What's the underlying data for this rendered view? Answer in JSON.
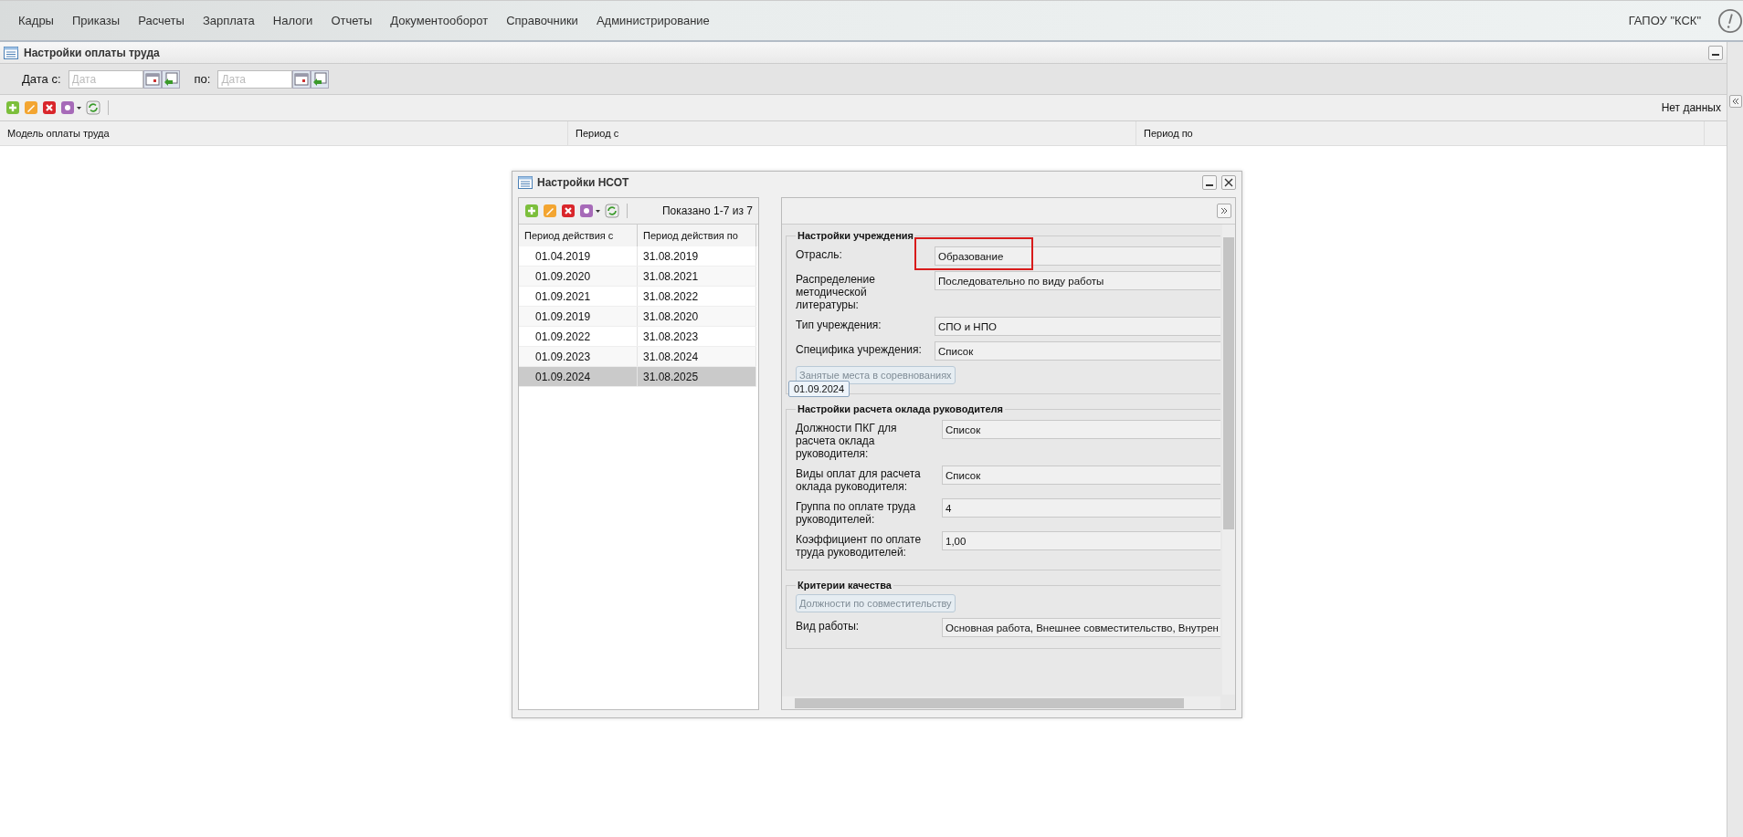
{
  "menu": [
    {
      "label": "Кадры"
    },
    {
      "label": "Приказы"
    },
    {
      "label": "Расчеты"
    },
    {
      "label": "Зарплата"
    },
    {
      "label": "Налоги"
    },
    {
      "label": "Отчеты"
    },
    {
      "label": "Документооборот"
    },
    {
      "label": "Справочники"
    },
    {
      "label": "Администрирование"
    }
  ],
  "organization": "ГАПОУ \"КСК\"",
  "panel": {
    "title": "Настройки оплаты труда",
    "filter": {
      "from_label": "Дата с:",
      "from_placeholder": "Дата",
      "to_label": "по:",
      "to_placeholder": "Дата"
    },
    "status": "Нет данных",
    "columns": [
      "Модель оплаты труда",
      "Период с",
      "Период по"
    ]
  },
  "dialog": {
    "title": "Настройки НСОТ",
    "count": "Показано 1-7 из 7",
    "columns": [
      "Период действия с",
      "Период действия по"
    ],
    "rows": [
      {
        "from": "01.04.2019",
        "to": "31.08.2019",
        "selected": false
      },
      {
        "from": "01.09.2020",
        "to": "31.08.2021",
        "selected": false
      },
      {
        "from": "01.09.2021",
        "to": "31.08.2022",
        "selected": false
      },
      {
        "from": "01.09.2019",
        "to": "31.08.2020",
        "selected": false
      },
      {
        "from": "01.09.2022",
        "to": "31.08.2023",
        "selected": false
      },
      {
        "from": "01.09.2023",
        "to": "31.08.2024",
        "selected": false
      },
      {
        "from": "01.09.2024",
        "to": "31.08.2025",
        "selected": true
      }
    ],
    "sections": [
      {
        "title": "Настройки учреждения",
        "tooltip": "01.09.2024",
        "items": [
          {
            "kind": "field",
            "label": "Отрасль:",
            "value": "Образование",
            "highlighted": true
          },
          {
            "kind": "field",
            "label": "Распределение методической литературы:",
            "value": "Последовательно по виду работы",
            "highlighted": false
          },
          {
            "kind": "field",
            "label": "Тип учреждения:",
            "value": "СПО и НПО",
            "highlighted": false
          },
          {
            "kind": "field",
            "label": "Специфика учреждения:",
            "value": "Список",
            "highlighted": false
          },
          {
            "kind": "button",
            "label": "Занятые места в соревнованиях",
            "disabled": true
          }
        ]
      },
      {
        "title": "Настройки расчета оклада руководителя",
        "items": [
          {
            "kind": "field",
            "label": "Должности ПКГ для расчета оклада руководителя:",
            "value": "Список",
            "highlighted": false
          },
          {
            "kind": "field",
            "label": "Виды оплат для расчета оклада руководителя:",
            "value": "Список",
            "highlighted": false
          },
          {
            "kind": "field",
            "label": "Группа по оплате труда руководителей:",
            "value": "4",
            "highlighted": false
          },
          {
            "kind": "field",
            "label": "Коэффициент по оплате труда руководителей:",
            "value": "1,00",
            "highlighted": false
          }
        ]
      },
      {
        "title": "Критерии качества",
        "items": [
          {
            "kind": "button",
            "label": "Должности по совместительству",
            "disabled": true
          },
          {
            "kind": "field",
            "label": "Вид работы:",
            "value": "Основная работа, Внешнее совместительство, Внутрен",
            "highlighted": false
          }
        ]
      }
    ]
  }
}
